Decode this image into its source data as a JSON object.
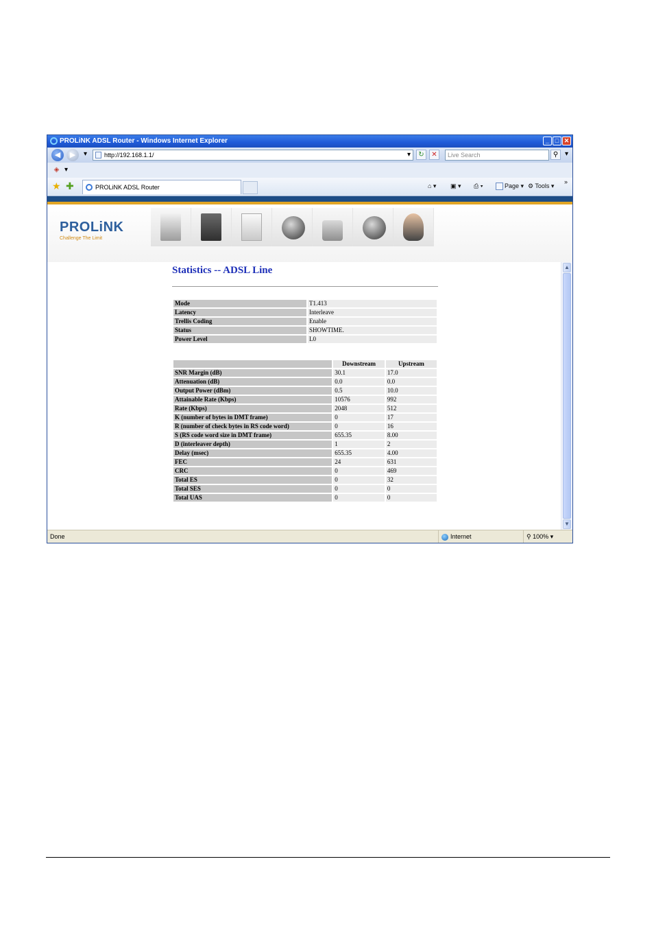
{
  "window": {
    "title": "PROLiNK ADSL Router - Windows Internet Explorer",
    "address": "http://192.168.1.1/",
    "search_placeholder": "Live Search",
    "tab_label": "PROLiNK ADSL Router",
    "commands": {
      "page": "Page",
      "tools": "Tools",
      "more": "»"
    },
    "status": {
      "left": "Done",
      "zone": "Internet",
      "zoom": "100%"
    }
  },
  "brand": {
    "logo": "PROLiNK",
    "tagline": "Challenge The Limit"
  },
  "nav_icons": [
    "monitor-icon",
    "gear-folder-icon",
    "tower-icon",
    "globe-icon",
    "lock-icon",
    "network-globe-icon",
    "user-icon"
  ],
  "page": {
    "title": "Statistics -- ADSL Line",
    "info": [
      {
        "label": "Mode",
        "value": "T1.413"
      },
      {
        "label": "Latency",
        "value": "Interleave"
      },
      {
        "label": "Trellis Coding",
        "value": "Enable"
      },
      {
        "label": "Status",
        "value": "SHOWTIME."
      },
      {
        "label": "Power Level",
        "value": "L0"
      }
    ],
    "stats_headers": {
      "down": "Downstream",
      "up": "Upstream"
    },
    "stats": [
      {
        "label": "SNR Margin (dB)",
        "down": "30.1",
        "up": "17.0"
      },
      {
        "label": "Attenuation (dB)",
        "down": "0.0",
        "up": "0.0"
      },
      {
        "label": "Output Power (dBm)",
        "down": "0.5",
        "up": "10.0"
      },
      {
        "label": "Attainable Rate (Kbps)",
        "down": "10576",
        "up": "992"
      },
      {
        "label": "Rate (Kbps)",
        "down": "2048",
        "up": "512"
      },
      {
        "label": "K (number of bytes in DMT frame)",
        "down": "0",
        "up": "17"
      },
      {
        "label": "R (number of check bytes in RS code word)",
        "down": "0",
        "up": "16"
      },
      {
        "label": "S (RS code word size in DMT frame)",
        "down": "655.35",
        "up": "8.00"
      },
      {
        "label": "D (interleaver depth)",
        "down": "1",
        "up": "2"
      },
      {
        "label": "Delay (msec)",
        "down": "655.35",
        "up": "4.00"
      },
      {
        "label": "FEC",
        "down": "24",
        "up": "631"
      },
      {
        "label": "CRC",
        "down": "0",
        "up": "469"
      },
      {
        "label": "Total ES",
        "down": "0",
        "up": "32"
      },
      {
        "label": "Total SES",
        "down": "0",
        "up": "0"
      },
      {
        "label": "Total UAS",
        "down": "0",
        "up": "0"
      }
    ]
  }
}
